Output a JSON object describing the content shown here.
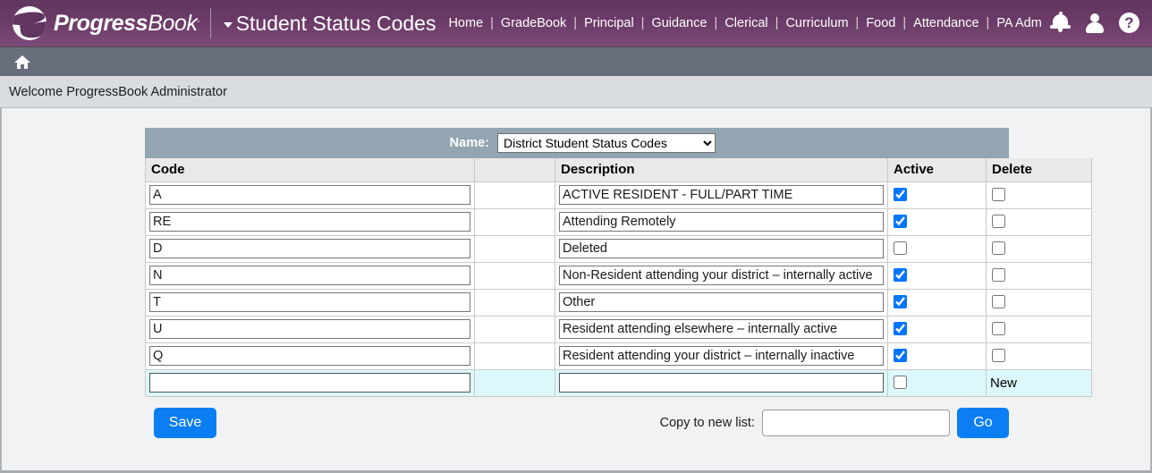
{
  "header": {
    "logo_text_bold": "Progress",
    "logo_text_thin": "Book",
    "logo_tm": ".",
    "page_title": "Student Status Codes",
    "nav_items": [
      "Home",
      "GradeBook",
      "Principal",
      "Guidance",
      "Clerical",
      "Curriculum",
      "Food",
      "Attendance",
      "PA Admin"
    ],
    "nav_separator": "|",
    "icons": [
      "bell-icon",
      "user-icon",
      "help-icon"
    ],
    "help_glyph": "?",
    "brand_purple": "#6b3b68"
  },
  "breadcrumb": {
    "home_icon": "home-icon"
  },
  "welcome": {
    "text": "Welcome ProgressBook Administrator"
  },
  "namebar": {
    "label": "Name:",
    "selected_option": "District Student Status Codes",
    "options": [
      "District Student Status Codes"
    ]
  },
  "table": {
    "headers": {
      "code": "Code",
      "blank": "",
      "description": "Description",
      "active": "Active",
      "delete": "Delete"
    },
    "rows": [
      {
        "code": "A",
        "description": "ACTIVE RESIDENT - FULL/PART TIME",
        "active": true,
        "delete": false,
        "new_label": ""
      },
      {
        "code": "RE",
        "description": "Attending Remotely",
        "active": true,
        "delete": false,
        "new_label": ""
      },
      {
        "code": "D",
        "description": "Deleted",
        "active": false,
        "delete": false,
        "new_label": ""
      },
      {
        "code": "N",
        "description": "Non-Resident attending your district – internally active",
        "active": true,
        "delete": false,
        "new_label": ""
      },
      {
        "code": "T",
        "description": "Other",
        "active": true,
        "delete": false,
        "new_label": ""
      },
      {
        "code": "U",
        "description": "Resident attending elsewhere – internally active",
        "active": true,
        "delete": false,
        "new_label": ""
      },
      {
        "code": "Q",
        "description": "Resident attending your district – internally inactive",
        "active": true,
        "delete": false,
        "new_label": ""
      },
      {
        "code": "",
        "description": "",
        "active": false,
        "delete": false,
        "new_label": "New"
      }
    ]
  },
  "footer": {
    "save_label": "Save",
    "copy_label": "Copy to new list:",
    "copy_value": "",
    "copy_placeholder": "",
    "go_label": "Go",
    "accent_blue": "#0b7ef4"
  }
}
